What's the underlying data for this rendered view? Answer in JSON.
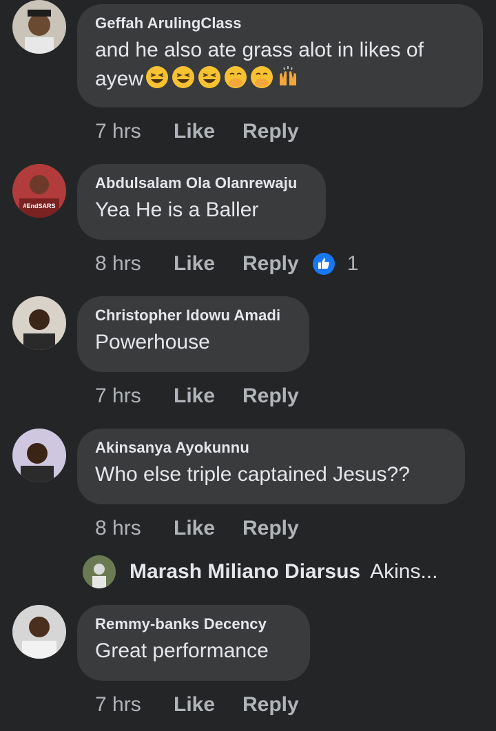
{
  "comments": [
    {
      "author": "Geffah ArulingClass",
      "text": "and he also ate grass alot in likes of",
      "text_line2": "ayew",
      "emojis": [
        "grinning-squinting-face",
        "grinning-squinting-face",
        "grinning-squinting-face",
        "face-with-hand-over-mouth",
        "face-with-hand-over-mouth",
        "raising-hands"
      ],
      "time": "7 hrs",
      "like_label": "Like",
      "reply_label": "Reply"
    },
    {
      "author": "Abdulsalam Ola Olanrewaju",
      "text": "Yea He is a Baller",
      "avatar_badge": "#EndSARS",
      "time": "8 hrs",
      "like_label": "Like",
      "reply_label": "Reply",
      "reaction_count": "1"
    },
    {
      "author": "Christopher Idowu Amadi",
      "text": "Powerhouse",
      "time": "7 hrs",
      "like_label": "Like",
      "reply_label": "Reply"
    },
    {
      "author": "Akinsanya Ayokunnu",
      "text": "Who else triple captained Jesus??",
      "time": "8 hrs",
      "like_label": "Like",
      "reply_label": "Reply"
    },
    {
      "author": "Remmy-banks Decency",
      "text": "Great performance",
      "time": "7 hrs",
      "like_label": "Like",
      "reply_label": "Reply"
    }
  ],
  "reply_preview": {
    "author": "Marash Miliano Diarsus",
    "snippet": "Akins..."
  },
  "colors": {
    "background": "#242526",
    "bubble": "#3a3b3c",
    "text": "#e4e6eb",
    "meta": "#b0b3b8",
    "like_blue": "#1877f2"
  }
}
